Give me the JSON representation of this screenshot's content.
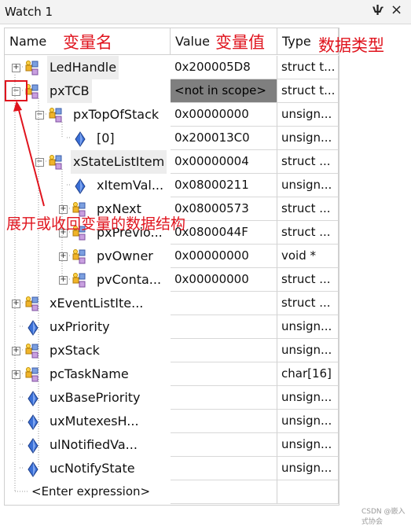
{
  "window": {
    "title": "Watch 1",
    "pin_glyph": "ѱ",
    "close_glyph": "×"
  },
  "headers": {
    "name": "Name",
    "value": "Value",
    "type": "Type"
  },
  "annotations": {
    "name": "变量名",
    "value": "变量值",
    "type": "数据类型",
    "expand": "展开或收回变量的数据结构"
  },
  "rows": [
    {
      "name": "LedHandle",
      "value": "0x200005D8",
      "type": "struct t...",
      "expander": "+",
      "icon": "struct-icon",
      "selected": true
    },
    {
      "name": "pxTCB",
      "value": "<not in scope>",
      "type": "struct t...",
      "expander": "-",
      "icon": "struct-icon",
      "selected": true,
      "not_in_scope": true
    },
    {
      "name": "pxTopOfStack",
      "value": "0x00000000",
      "type": "unsign...",
      "expander": "-",
      "icon": "struct-icon"
    },
    {
      "name": "[0]",
      "value": "0x200013C0",
      "type": "unsign...",
      "expander": "",
      "icon": "variable-icon"
    },
    {
      "name": "xStateListItem",
      "value": "0x00000004",
      "type": "struct ...",
      "expander": "-",
      "icon": "struct-icon",
      "selected": true
    },
    {
      "name": "xItemVal...",
      "value": "0x08000211",
      "type": "unsign...",
      "expander": "",
      "icon": "variable-icon"
    },
    {
      "name": "pxNext",
      "value": "0x08000573",
      "type": "struct ...",
      "expander": "+",
      "icon": "struct-icon"
    },
    {
      "name": "pxPrevio...",
      "value": "0x0800044F",
      "type": "struct ...",
      "expander": "+",
      "icon": "struct-icon"
    },
    {
      "name": "pvOwner",
      "value": "0x00000000",
      "type": "void *",
      "expander": "+",
      "icon": "struct-icon"
    },
    {
      "name": "pvConta...",
      "value": "0x00000000",
      "type": "struct ...",
      "expander": "+",
      "icon": "struct-icon"
    },
    {
      "name": "xEventListIte...",
      "value": "",
      "type": "struct ...",
      "expander": "+",
      "icon": "struct-icon"
    },
    {
      "name": "uxPriority",
      "value": "",
      "type": "unsign...",
      "expander": "",
      "icon": "variable-icon"
    },
    {
      "name": "pxStack",
      "value": "",
      "type": "unsign...",
      "expander": "+",
      "icon": "struct-icon"
    },
    {
      "name": "pcTaskName",
      "value": "",
      "type": "char[16]",
      "expander": "+",
      "icon": "struct-icon"
    },
    {
      "name": "uxBasePriority",
      "value": "",
      "type": "unsign...",
      "expander": "",
      "icon": "variable-icon"
    },
    {
      "name": "uxMutexesH...",
      "value": "",
      "type": "unsign...",
      "expander": "",
      "icon": "variable-icon"
    },
    {
      "name": "ulNotifiedVa...",
      "value": "",
      "type": "unsign...",
      "expander": "",
      "icon": "variable-icon"
    },
    {
      "name": "ucNotifyState",
      "value": "",
      "type": "unsign...",
      "expander": "",
      "icon": "variable-icon"
    },
    {
      "name": "<Enter expression>",
      "value": "",
      "type": "",
      "expander": "",
      "icon": ""
    }
  ],
  "watermark": "CSDN @嵌入式协会",
  "colors": {
    "annotation": "#e0141e",
    "not_in_scope_bg": "#7f7f7f",
    "selected_bg": "#ededed"
  }
}
